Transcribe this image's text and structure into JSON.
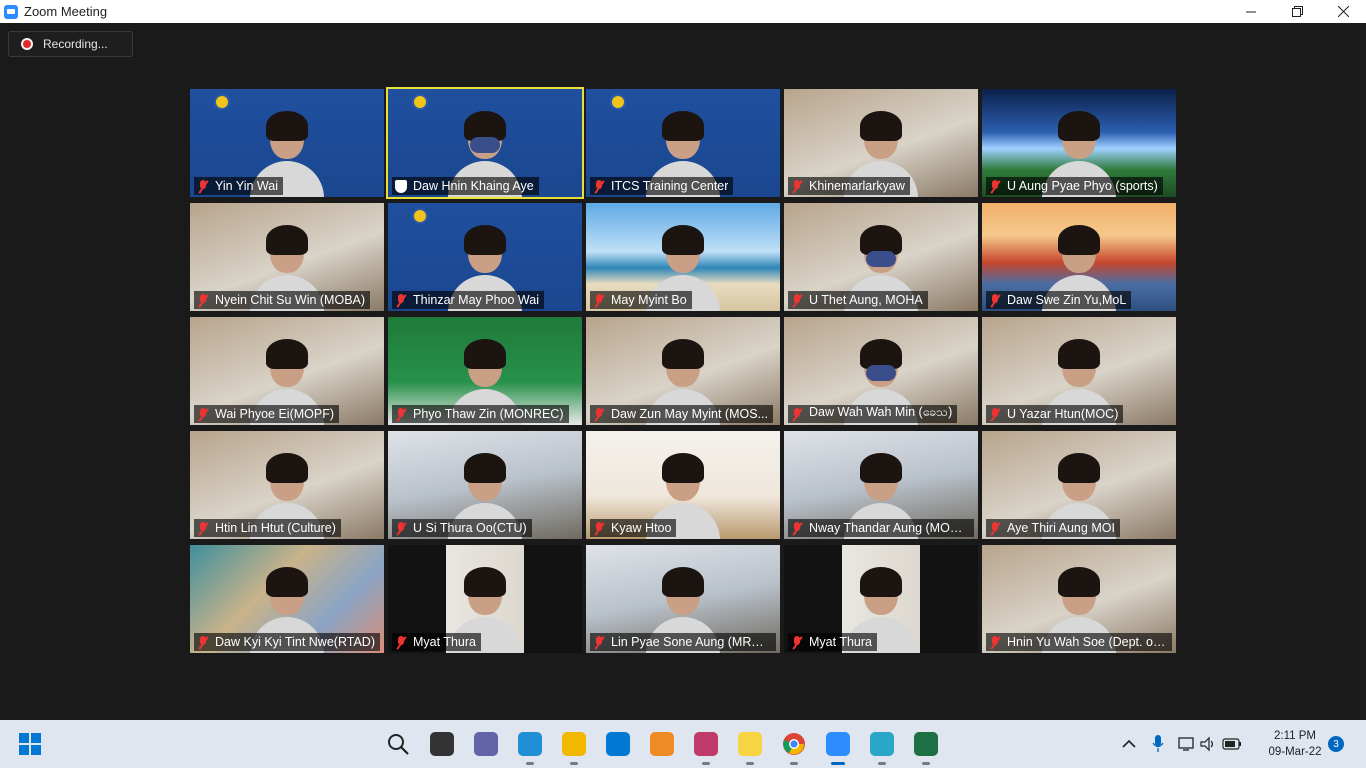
{
  "window": {
    "title": "Zoom Meeting"
  },
  "recording": {
    "label": "Recording..."
  },
  "participants": [
    {
      "name": "Yin Yin Wai",
      "muted": true,
      "bg": "slide"
    },
    {
      "name": "Daw Hnin Khaing Aye",
      "muted": false,
      "bg": "slide",
      "active_speaker": true
    },
    {
      "name": "ITCS Training Center",
      "muted": true,
      "bg": "slide"
    },
    {
      "name": "Khinemarlarkyaw",
      "muted": true,
      "bg": "room"
    },
    {
      "name": "U Aung Pyae Phyo (sports)",
      "muted": true,
      "bg": "stadium"
    },
    {
      "name": "Nyein Chit Su Win (MOBA)",
      "muted": true,
      "bg": "room"
    },
    {
      "name": "Thinzar May Phoo Wai",
      "muted": true,
      "bg": "slide"
    },
    {
      "name": "May Myint Bo",
      "muted": true,
      "bg": "beach"
    },
    {
      "name": "U Thet Aung, MOHA",
      "muted": true,
      "bg": "room"
    },
    {
      "name": "Daw Swe Zin Yu,MoL",
      "muted": true,
      "bg": "bridge"
    },
    {
      "name": "Wai Phyoe Ei(MOPF)",
      "muted": true,
      "bg": "room"
    },
    {
      "name": "Phyo Thaw Zin (MONREC)",
      "muted": true,
      "bg": "green"
    },
    {
      "name": "Daw Zun May Myint (MOS...",
      "muted": true,
      "bg": "room"
    },
    {
      "name": "Daw Wah Wah Min (ခေသ)",
      "muted": true,
      "bg": "room"
    },
    {
      "name": "U Yazar Htun(MOC)",
      "muted": true,
      "bg": "room"
    },
    {
      "name": "Htin Lin Htut (Culture)",
      "muted": true,
      "bg": "room"
    },
    {
      "name": "U Si Thura Oo(CTU)",
      "muted": true,
      "bg": "office"
    },
    {
      "name": "Kyaw Htoo",
      "muted": true,
      "bg": "cafe"
    },
    {
      "name": "Nway Thandar Aung (MOLA)",
      "muted": true,
      "bg": "office"
    },
    {
      "name": "Aye Thiri Aung MOI",
      "muted": true,
      "bg": "room"
    },
    {
      "name": "Daw Kyi Kyi Tint Nwe(RTAD)",
      "muted": true,
      "bg": "blur"
    },
    {
      "name": "Myat Thura",
      "muted": true,
      "bg": "dark"
    },
    {
      "name": "Lin Pyae Sone Aung (MRTV)",
      "muted": true,
      "bg": "office"
    },
    {
      "name": "Myat Thura",
      "muted": true,
      "bg": "dark"
    },
    {
      "name": "Hnin Yu Wah Soe (Dept. of ...",
      "muted": true,
      "bg": "room"
    }
  ],
  "taskbar": {
    "apps": [
      {
        "name": "start-icon",
        "color": "#0078d4"
      },
      {
        "name": "search-icon",
        "color": "#222222"
      },
      {
        "name": "task-view-icon",
        "color": "#333333"
      },
      {
        "name": "chat-icon",
        "color": "#6264a7"
      },
      {
        "name": "edge-icon",
        "color": "#1f8fd6"
      },
      {
        "name": "file-explorer-icon",
        "color": "#f2b800"
      },
      {
        "name": "mail-icon",
        "color": "#0078d4"
      },
      {
        "name": "sublime-icon",
        "color": "#f08a24"
      },
      {
        "name": "snipping-tool-icon",
        "color": "#c03a6a"
      },
      {
        "name": "sticky-notes-icon",
        "color": "#f7d441"
      },
      {
        "name": "chrome-icon",
        "color": "#db4437"
      },
      {
        "name": "zoom-icon",
        "color": "#2d8cff"
      },
      {
        "name": "maps-icon",
        "color": "#2aa6c7"
      },
      {
        "name": "excel-icon",
        "color": "#1d7044"
      }
    ],
    "clock": {
      "time": "2:11 PM",
      "date": "09-Mar-22"
    },
    "notifications": "3"
  }
}
